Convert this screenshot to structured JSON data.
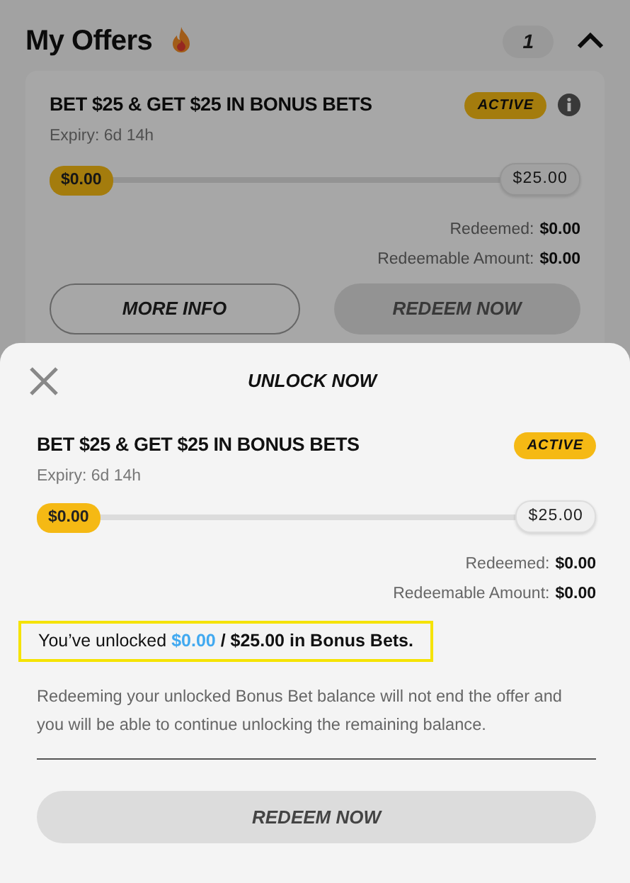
{
  "header": {
    "title": "My Offers",
    "count": "1",
    "expanded": true
  },
  "offer_card": {
    "title": "BET $25 & GET $25 IN BONUS BETS",
    "status": "ACTIVE",
    "expiry": "Expiry: 6d 14h",
    "progress": {
      "start": "$0.00",
      "end": "$25.00",
      "level": 0
    },
    "stats": [
      {
        "label": "Redeemed:",
        "value": "$0.00"
      },
      {
        "label": "Redeemable Amount:",
        "value": "$0.00"
      }
    ],
    "buttons": [
      {
        "label": "MORE INFO",
        "kind": "outline",
        "disabled": false
      },
      {
        "label": "REDEEM NOW",
        "kind": "filled",
        "disabled": true
      }
    ]
  },
  "sheet": {
    "title": "UNLOCK NOW",
    "offer": {
      "title": "BET $25 & GET $25 IN BONUS BETS",
      "status": "ACTIVE",
      "expiry": "Expiry: 6d 14h",
      "progress": {
        "start": "$0.00",
        "end": "$25.00",
        "level": 0
      },
      "stats": [
        {
          "label": "Redeemed:",
          "value": "$0.00"
        },
        {
          "label": "Redeemable Amount:",
          "value": "$0.00"
        }
      ]
    },
    "unlocked": {
      "prefix": "You’ve unlocked",
      "amount": "$0.00",
      "suffix": "/ $25.00 in Bonus Bets.",
      "highlighted": true
    },
    "note": "Redeeming your unlocked Bonus Bet balance will not end the offer and you will be able to continue unlocking the remaining balance.",
    "button": {
      "label": "REDEEM NOW",
      "disabled": true
    }
  }
}
